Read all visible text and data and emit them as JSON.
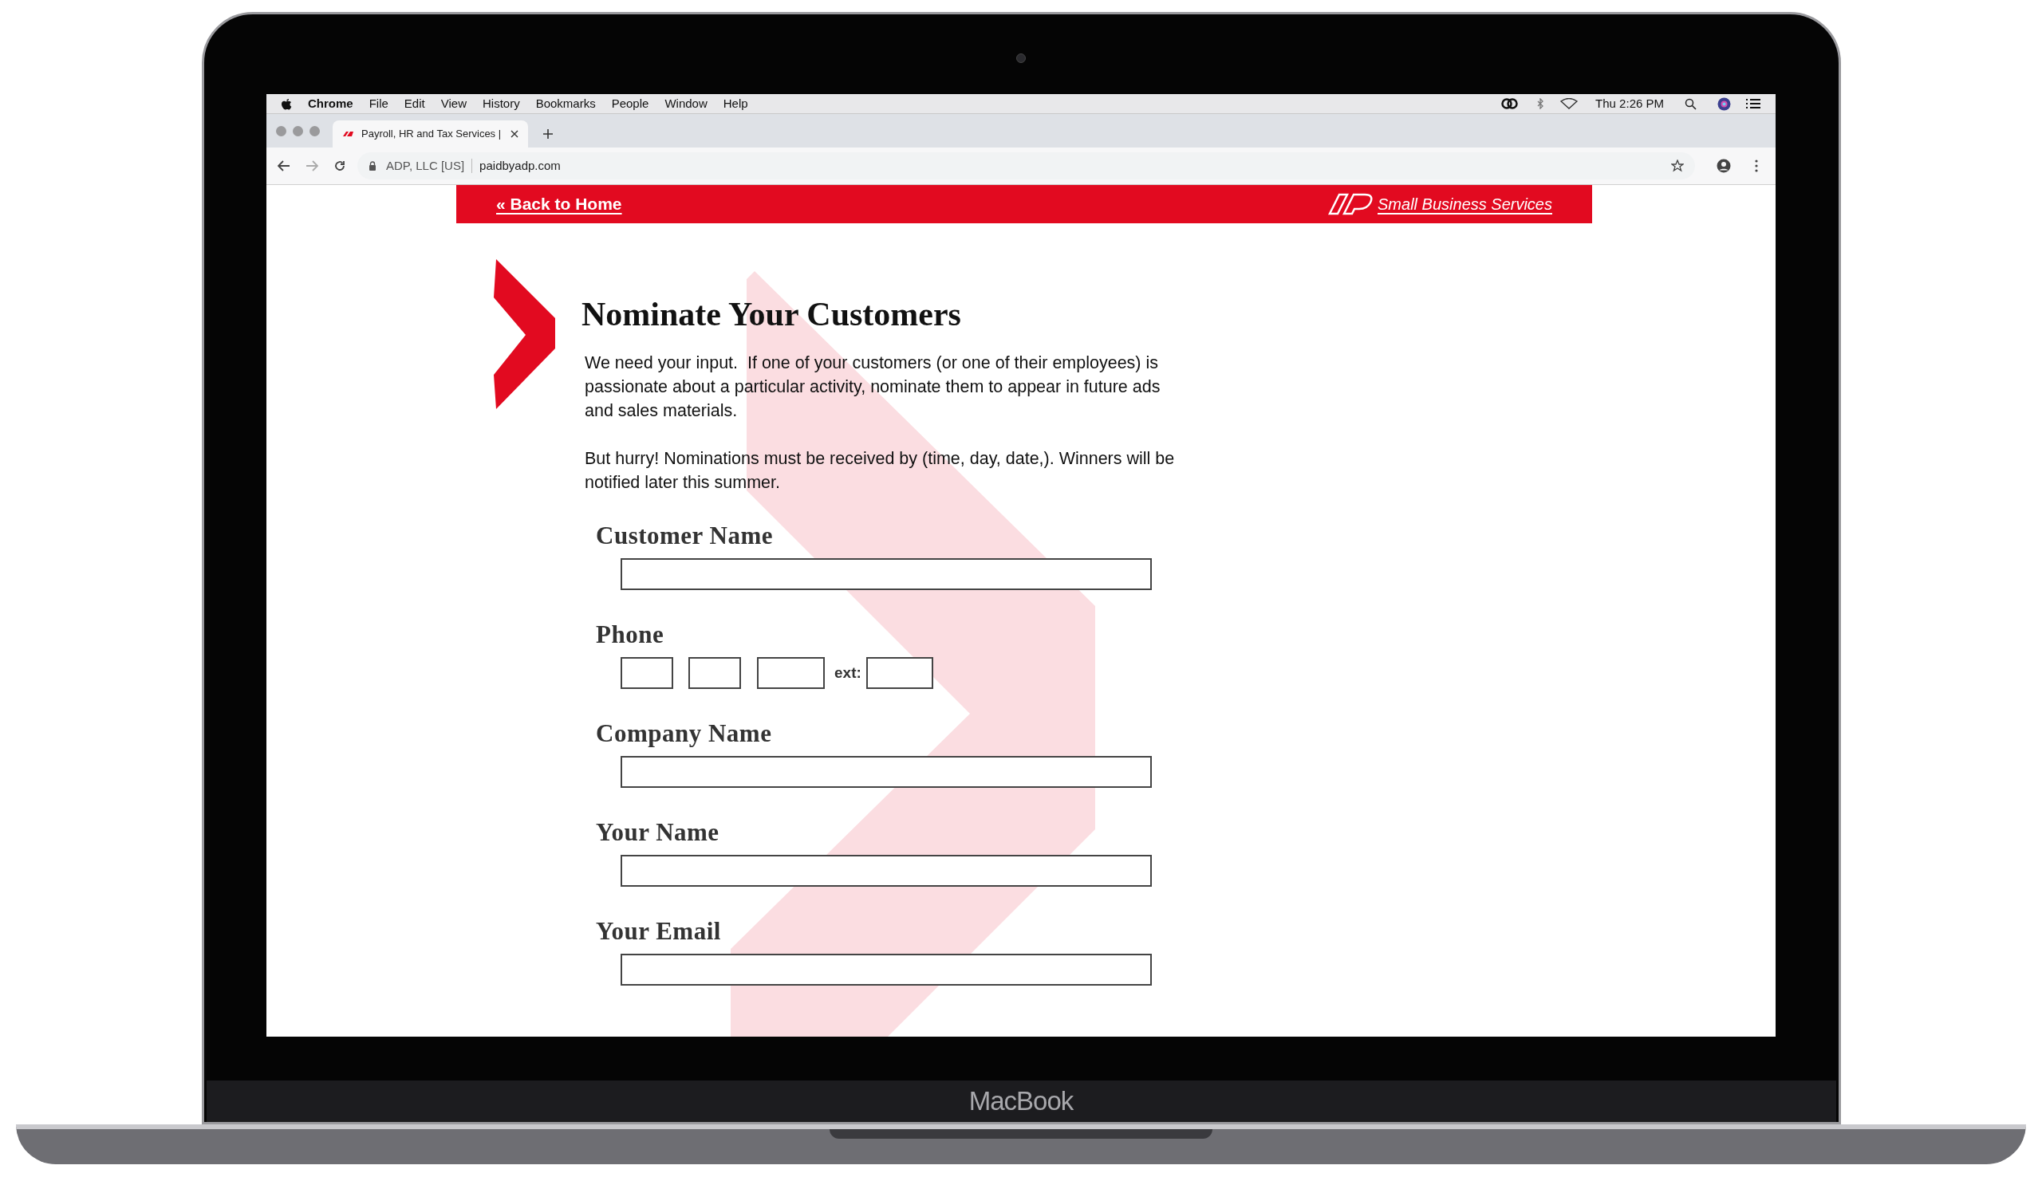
{
  "menu_bar": {
    "app": "Chrome",
    "items": [
      "File",
      "Edit",
      "View",
      "History",
      "Bookmarks",
      "People",
      "Window",
      "Help"
    ],
    "clock": "Thu 2:26 PM"
  },
  "tab": {
    "title": "Payroll, HR and Tax Services |",
    "selected": true
  },
  "address_bar": {
    "site": "ADP, LLC [US]",
    "url": "paidbyadp.com"
  },
  "header": {
    "link": "« Back to Home",
    "brand": "Small Business Services"
  },
  "title": "Nominate Your Customers",
  "paragraphs": [
    "We need your input.  If one of your customers (or one of their employees) is passionate about a particular activity, nominate them to appear in future ads and sales materials.",
    "But hurry! Nominations must be received by (time, day, date,). Winners will be notified later this summer."
  ],
  "fields": [
    {
      "label": "Customer Name",
      "kind": "text"
    },
    {
      "label": "Phone",
      "kind": "phone",
      "ext_label": "ext:"
    },
    {
      "label": "Company Name",
      "kind": "text"
    },
    {
      "label": "Your Name",
      "kind": "text"
    },
    {
      "label": "Your Email",
      "kind": "text"
    }
  ],
  "device_label": "MacBook"
}
